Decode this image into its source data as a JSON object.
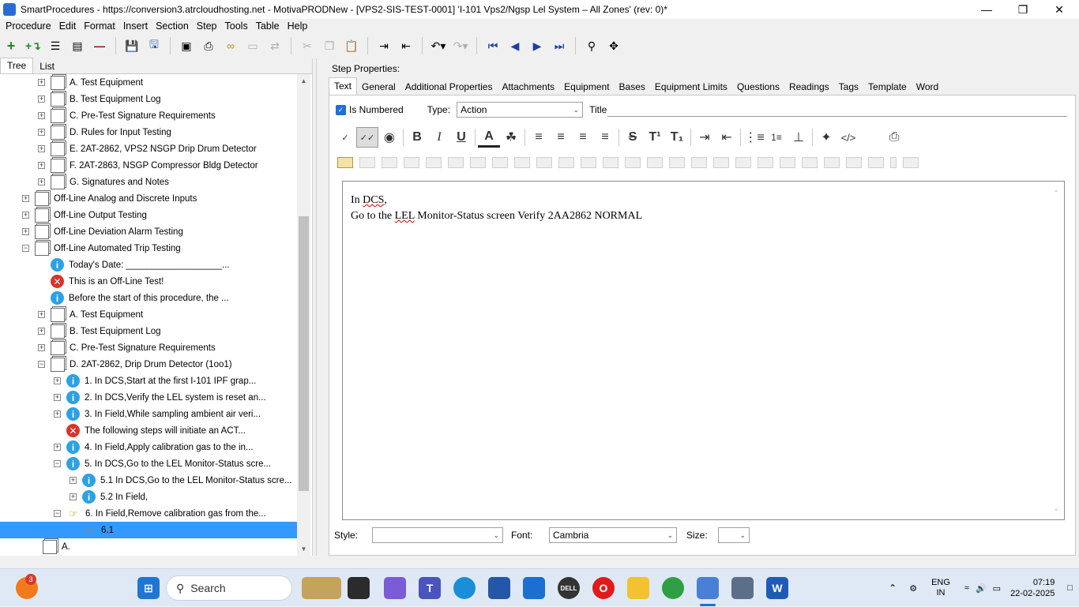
{
  "window": {
    "title": "SmartProcedures - https://conversion3.atrcloudhosting.net - MotivaPRODNew - [VPS2-SIS-TEST-0001] 'I-101 Vps2/Ngsp Lel System – All Zones' (rev: 0)*",
    "minimize": "—",
    "restore": "❐",
    "close": "✕"
  },
  "menu": [
    "Procedure",
    "Edit",
    "Format",
    "Insert",
    "Section",
    "Step",
    "Tools",
    "Table",
    "Help"
  ],
  "left_tabs": [
    "Tree",
    "List"
  ],
  "tree": [
    {
      "indent": 1,
      "exp": "+",
      "icon": "doc",
      "label": "A. Test Equipment"
    },
    {
      "indent": 1,
      "exp": "+",
      "icon": "doc",
      "label": "B. Test Equipment Log"
    },
    {
      "indent": 1,
      "exp": "+",
      "icon": "doc",
      "label": "C. Pre-Test Signature Requirements"
    },
    {
      "indent": 1,
      "exp": "+",
      "icon": "doc",
      "label": "D. Rules for Input Testing"
    },
    {
      "indent": 1,
      "exp": "+",
      "icon": "doc",
      "label": "E. 2AT-2862, VPS2 NSGP Drip Drum Detector"
    },
    {
      "indent": 1,
      "exp": "+",
      "icon": "doc",
      "label": "F. 2AT-2863, NSGP Compressor Bldg Detector"
    },
    {
      "indent": 1,
      "exp": "+",
      "icon": "doc",
      "label": "G. Signatures and Notes"
    },
    {
      "indent": 0,
      "exp": "+",
      "icon": "doc",
      "label": "Off-Line Analog and Discrete Inputs"
    },
    {
      "indent": 0,
      "exp": "+",
      "icon": "doc",
      "label": "Off-Line Output Testing"
    },
    {
      "indent": 0,
      "exp": "+",
      "icon": "doc",
      "label": "Off-Line Deviation Alarm Testing"
    },
    {
      "indent": 0,
      "exp": "−",
      "icon": "doc",
      "label": "Off-Line Automated Trip Testing"
    },
    {
      "indent": 1,
      "exp": "",
      "icon": "info",
      "label": "Today's Date: ___________________..."
    },
    {
      "indent": 1,
      "exp": "",
      "icon": "warn",
      "label": "This is an Off-Line Test!"
    },
    {
      "indent": 1,
      "exp": "",
      "icon": "info",
      "label": "Before the start of this procedure, the ..."
    },
    {
      "indent": 1,
      "exp": "+",
      "icon": "doc",
      "label": "A. Test Equipment"
    },
    {
      "indent": 1,
      "exp": "+",
      "icon": "doc",
      "label": "B. Test Equipment Log"
    },
    {
      "indent": 1,
      "exp": "+",
      "icon": "doc",
      "label": "C. Pre-Test Signature Requirements"
    },
    {
      "indent": 1,
      "exp": "−",
      "icon": "doc",
      "label": "D. 2AT-2862, Drip Drum Detector (1oo1)"
    },
    {
      "indent": 2,
      "exp": "+",
      "icon": "info",
      "label": "1. In DCS,Start at the first I-101 IPF grap..."
    },
    {
      "indent": 2,
      "exp": "+",
      "icon": "info",
      "label": "2. In DCS,Verify the LEL system is reset an..."
    },
    {
      "indent": 2,
      "exp": "+",
      "icon": "info",
      "label": "3. In Field,While sampling ambient air veri..."
    },
    {
      "indent": 2,
      "exp": "",
      "icon": "warn",
      "label": "The following steps will initiate an ACT..."
    },
    {
      "indent": 2,
      "exp": "+",
      "icon": "info",
      "label": "4. In Field,Apply calibration gas to the in..."
    },
    {
      "indent": 2,
      "exp": "−",
      "icon": "info",
      "label": "5. In DCS,Go to the LEL Monitor-Status scre..."
    },
    {
      "indent": 3,
      "exp": "+",
      "icon": "info",
      "label": "5.1 In DCS,Go to the LEL Monitor-Status scre..."
    },
    {
      "indent": 3,
      "exp": "+",
      "icon": "info",
      "label": "5.2 In Field,"
    },
    {
      "indent": 2,
      "exp": "−",
      "icon": "hand",
      "label": "6. In Field,Remove calibration gas from the..."
    },
    {
      "indent": 3,
      "exp": "",
      "icon": "hand",
      "label": "6.1",
      "selected": true
    },
    {
      "indent": 0.5,
      "exp": "",
      "icon": "doc",
      "label": "A."
    }
  ],
  "step_properties": {
    "heading": "Step Properties:",
    "tabs": [
      "Text",
      "General",
      "Additional Properties",
      "Attachments",
      "Equipment",
      "Bases",
      "Equipment Limits",
      "Questions",
      "Readings",
      "Tags",
      "Template",
      "Word"
    ],
    "is_numbered_label": "Is Numbered",
    "type_label": "Type:",
    "type_value": "Action",
    "title_label": "Title:",
    "title_value": ""
  },
  "editor": {
    "line1_a": "In ",
    "line1_b": "DCS",
    "line1_c": ",",
    "line2_a": "Go to the ",
    "line2_b": "LEL",
    "line2_c": " Monitor-Status screen Verify   2AA2862 NORMAL"
  },
  "bottom": {
    "style_label": "Style:",
    "style_value": "",
    "font_label": "Font:",
    "font_value": "Cambria",
    "size_label": "Size:",
    "size_value": ""
  },
  "taskbar": {
    "notification_count": "3",
    "search_label": "Search",
    "lang_top": "ENG",
    "lang_bottom": "IN",
    "time": "07:19",
    "date": "22-02-2025"
  }
}
